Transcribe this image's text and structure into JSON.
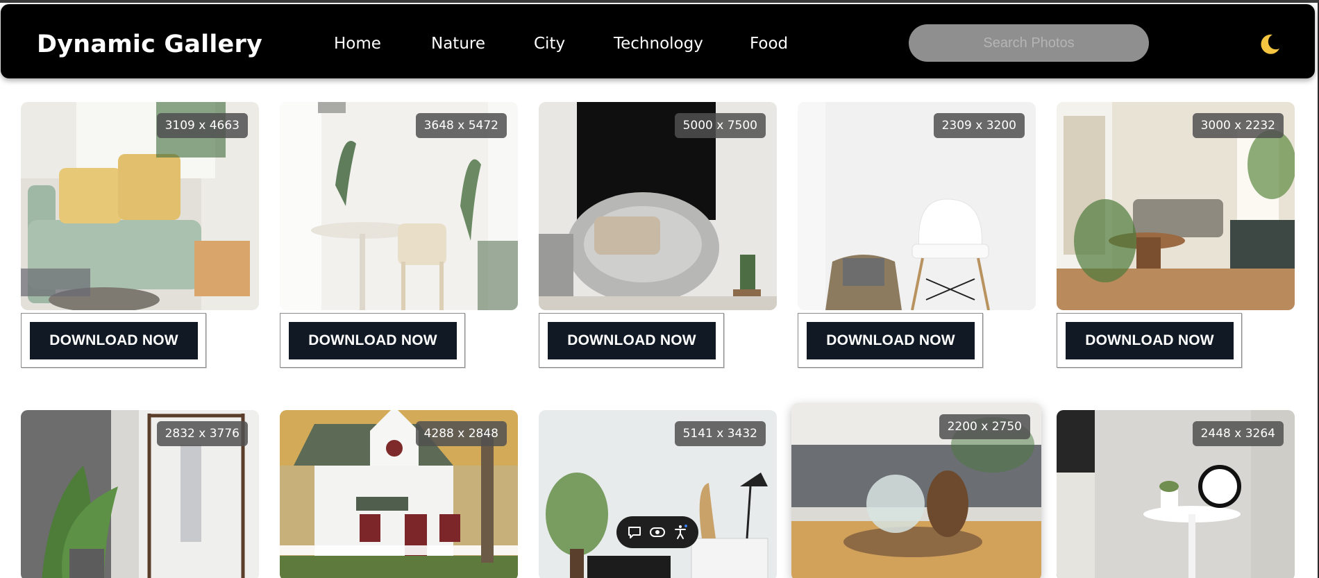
{
  "header": {
    "brand": "Dynamic Gallery",
    "nav": [
      "Home",
      "Nature",
      "City",
      "Technology",
      "Food"
    ],
    "search_placeholder": "Search Photos",
    "theme_icon": "moon-icon"
  },
  "gallery": {
    "download_label": "DOWNLOAD NOW",
    "row1": [
      {
        "dims": "3109 x 4663",
        "scene": "sofa-room"
      },
      {
        "dims": "3648 x 5472",
        "scene": "table-chair"
      },
      {
        "dims": "5000 x 7500",
        "scene": "grey-armchair"
      },
      {
        "dims": "2309 x 3200",
        "scene": "white-chair"
      },
      {
        "dims": "3000 x 2232",
        "scene": "living-room"
      }
    ],
    "row2": [
      {
        "dims": "2832 x 3776",
        "scene": "clothes-rack"
      },
      {
        "dims": "4288 x 2848",
        "scene": "white-house"
      },
      {
        "dims": "5141 x 3432",
        "scene": "sideboard"
      },
      {
        "dims": "2200 x 2750",
        "scene": "pinecone-table"
      },
      {
        "dims": "2448 x 3264",
        "scene": "alarm-clock"
      }
    ]
  },
  "floating_toolbar": {
    "icons": [
      "chat-icon",
      "eye-icon",
      "accessibility-icon"
    ]
  },
  "colors": {
    "navbar": "#000000",
    "button": "#111a24",
    "search": "#8f8f8f",
    "moon": "#f5c542"
  }
}
